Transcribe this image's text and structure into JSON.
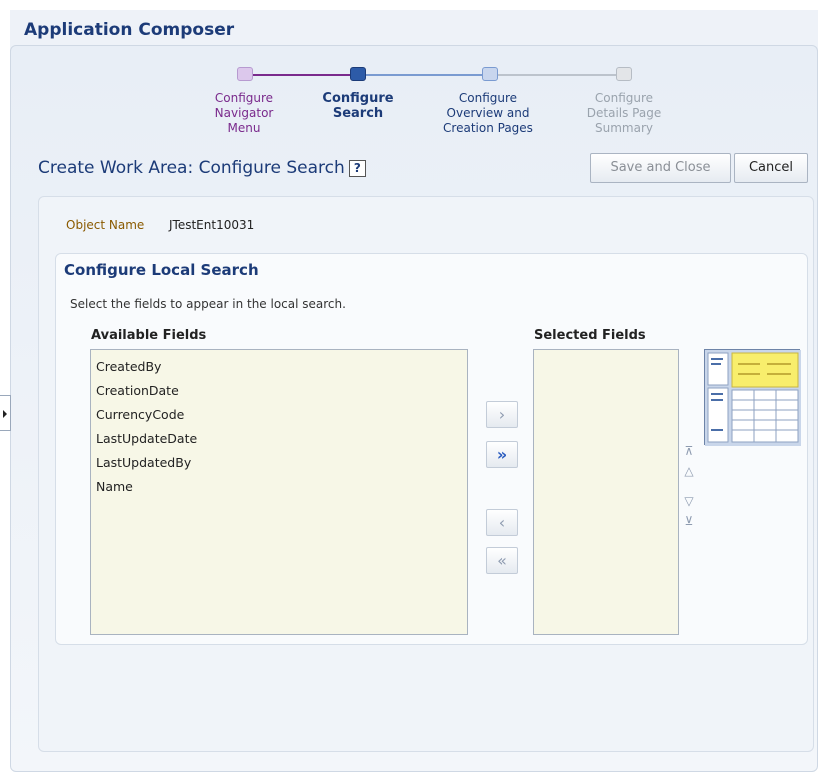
{
  "app": {
    "title": "Application Composer"
  },
  "train": {
    "steps": [
      {
        "label_lines": [
          "Configure",
          "Navigator",
          "Menu"
        ],
        "state": "visited",
        "color": "#7a2a8c"
      },
      {
        "label_lines": [
          "Configure",
          "Search"
        ],
        "state": "current",
        "color": "#1c3b78"
      },
      {
        "label_lines": [
          "Configure",
          "Overview and",
          "Creation Pages"
        ],
        "state": "next",
        "color": "#1c3b78"
      },
      {
        "label_lines": [
          "Configure",
          "Details Page",
          "Summary"
        ],
        "state": "disabled",
        "color": "#9aa3ad"
      }
    ]
  },
  "page": {
    "title": "Create Work Area: Configure Search",
    "help_icon_label": "?",
    "save_close_label": "Save and Close",
    "cancel_label": "Cancel"
  },
  "object": {
    "label": "Object Name",
    "value": "JTestEnt10031"
  },
  "local_search": {
    "title": "Configure Local Search",
    "instructions": "Select the fields to appear in the local search.",
    "available_header": "Available Fields",
    "selected_header": "Selected Fields",
    "available_fields": [
      "CreatedBy",
      "CreationDate",
      "CurrencyCode",
      "LastUpdateDate",
      "LastUpdatedBy",
      "Name"
    ],
    "selected_fields": []
  },
  "shuttle": {
    "move_icon": "›",
    "move_all_icon": "»",
    "remove_icon": "‹",
    "remove_all_icon": "«"
  },
  "reorder": {
    "top_icon": "⊼",
    "up_icon": "△",
    "down_icon": "▽",
    "bottom_icon": "⊻"
  },
  "colors": {
    "accent": "#1c3b78",
    "listbox_bg": "#f7f7e7",
    "preview_highlight": "#f8ee6c"
  }
}
